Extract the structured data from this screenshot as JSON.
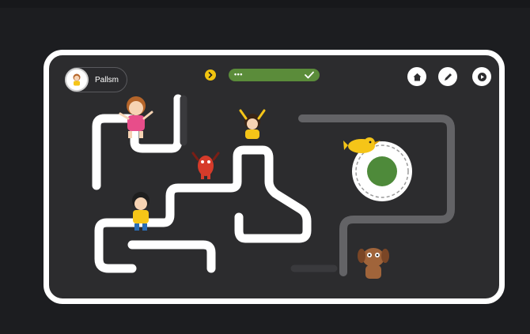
{
  "player": {
    "name": "Pallsm"
  },
  "progress": {
    "dots": "•••",
    "complete": true
  },
  "toolbar": {
    "icons": [
      "home-icon",
      "pencil-icon",
      "play-icon"
    ]
  },
  "colors": {
    "board": "#2c2c2e",
    "track": "#ffffff",
    "track_dim": "#636366",
    "progress": "#5b8c3a",
    "nav": "#f1c40f",
    "target": "#4e8a3a",
    "bird": "#f5c518"
  }
}
